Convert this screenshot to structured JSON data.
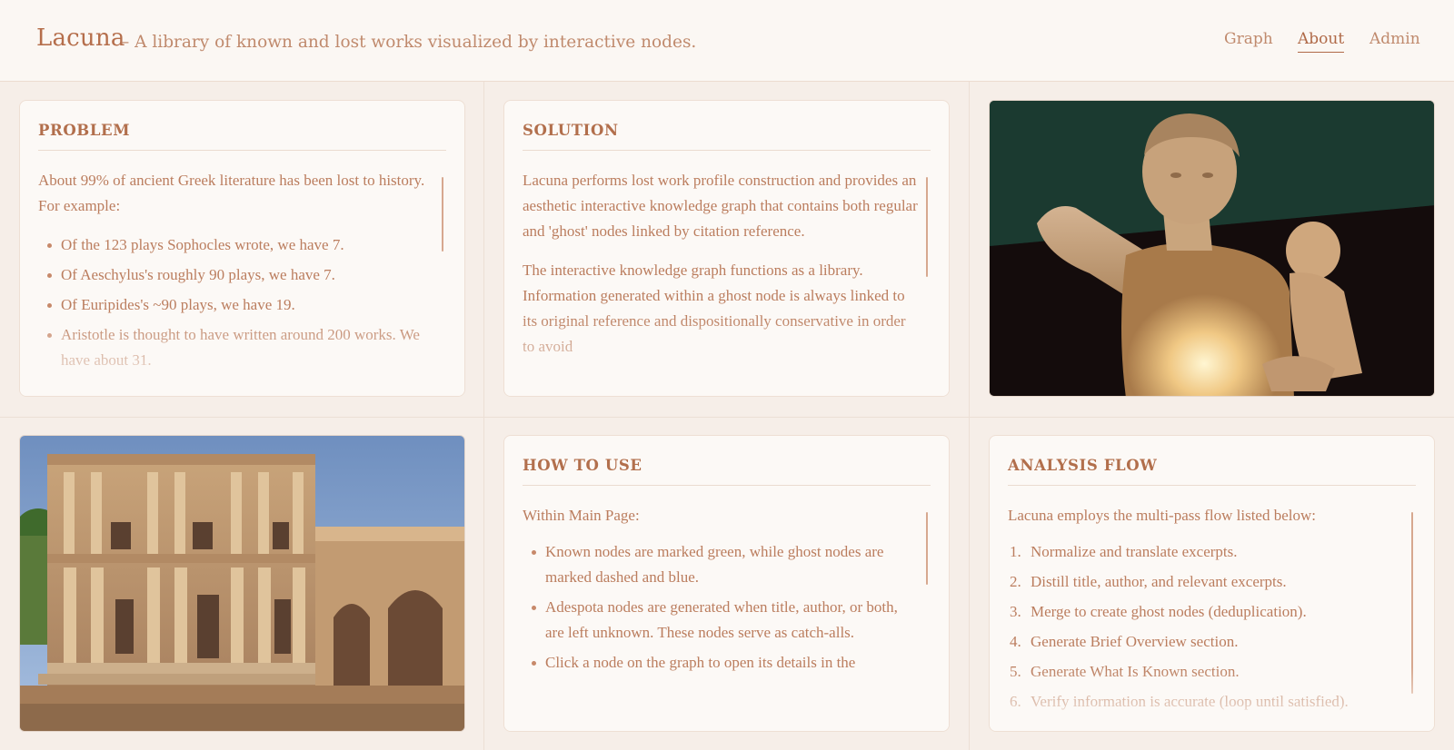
{
  "header": {
    "brand": "Lacuna",
    "tagline": "– A library of known and lost works visualized by interactive nodes.",
    "nav": [
      "Graph",
      "About",
      "Admin"
    ],
    "active_nav": "About"
  },
  "problem": {
    "title": "PROBLEM",
    "intro": "About 99% of ancient Greek literature has been lost to history. For example:",
    "items": [
      "Of the 123 plays Sophocles wrote, we have 7.",
      "Of Aeschylus's roughly 90 plays, we have 7.",
      "Of Euripides's ~90 plays, we have 19.",
      "Aristotle is thought to have written around 200 works. We have about 31."
    ]
  },
  "solution": {
    "title": "SOLUTION",
    "p1": "Lacuna performs lost work profile construction and provides an aesthetic interactive knowledge graph that contains both regular and 'ghost' nodes linked by citation reference.",
    "p2": "The interactive knowledge graph functions as a library. Information generated within a ghost node is always linked to its original reference and dispositionally conservative in order to avoid"
  },
  "how_to_use": {
    "title": "HOW TO USE",
    "intro": "Within Main Page:",
    "items": [
      "Known nodes are marked green, while ghost nodes are marked dashed and blue.",
      "Adespota nodes are generated when title, author, or both, are left unknown. These nodes serve as catch-alls.",
      "Click a node on the graph to open its details in the"
    ]
  },
  "analysis_flow": {
    "title": "ANALYSIS FLOW",
    "intro": "Lacuna employs the multi-pass flow listed below:",
    "items": [
      {
        "n": "1.",
        "text": "Normalize and translate excerpts."
      },
      {
        "n": "2.",
        "text": "Distill title, author, and relevant excerpts."
      },
      {
        "n": "3.",
        "text": "Merge to create ghost nodes (deduplication)."
      },
      {
        "n": "4.",
        "text": "Generate Brief Overview section."
      },
      {
        "n": "5.",
        "text": "Generate What Is Known section."
      },
      {
        "n": "6.",
        "text": "Verify information is accurate (loop until satisfied)."
      }
    ]
  },
  "colors": {
    "background": "#f6eee8",
    "card": "#fcf9f6",
    "accent": "#b26f4c"
  }
}
